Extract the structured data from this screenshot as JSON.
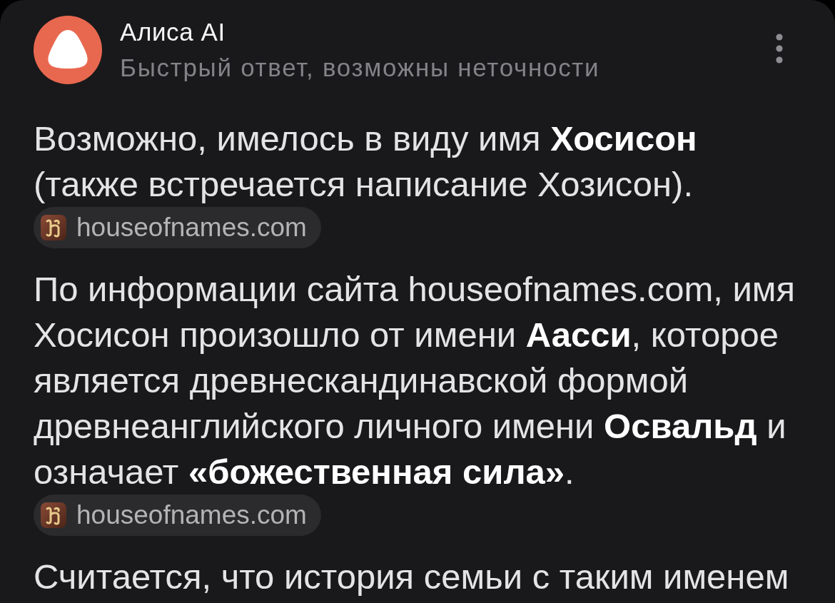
{
  "header": {
    "title": "Алиса AI",
    "subtitle": "Быстрый ответ, возможны неточности"
  },
  "answer": [
    {
      "kind": "paragraph",
      "text": "Возможно, имелось в виду имя **Хосисон** (также встречается написание Хозисон)."
    },
    {
      "kind": "source",
      "label": "houseofnames.com"
    },
    {
      "kind": "paragraph",
      "text": "По информации сайта houseofnames.com, имя Хосисон произошло от имени **Аасси**, которое является древнескандинавской формой древнеанглийского личного имени **Освальд** и означает **«божественная сила»**."
    },
    {
      "kind": "source",
      "label": "houseofnames.com"
    },
    {
      "kind": "paragraph",
      "text": "Считается, что история семьи с таким именем"
    }
  ]
}
